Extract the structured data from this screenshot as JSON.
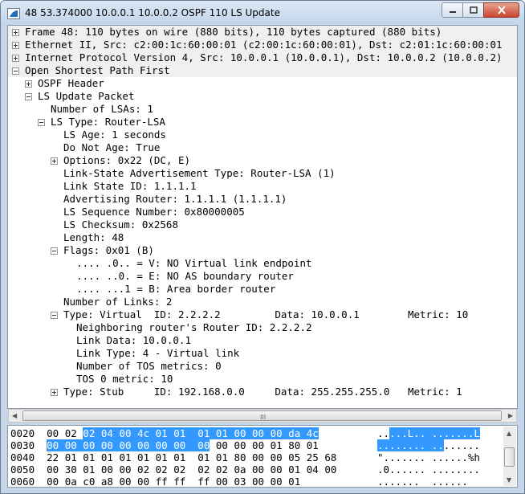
{
  "window": {
    "title": "48 53.374000 10.0.0.1 10.0.0.2 OSPF 110 LS Update",
    "minimize_label": "–",
    "maximize_label": "□",
    "close_label": "✕"
  },
  "tree": [
    {
      "text": "Frame 48: 110 bytes on wire (880 bits), 110 bytes captured (880 bits)",
      "expander": "plus"
    },
    {
      "text": "Ethernet II, Src: c2:00:1c:60:00:01 (c2:00:1c:60:00:01), Dst: c2:01:1c:60:00:01",
      "expander": "plus"
    },
    {
      "text": "Internet Protocol Version 4, Src: 10.0.0.1 (10.0.0.1), Dst: 10.0.0.2 (10.0.0.2)",
      "expander": "plus"
    },
    {
      "text": "Open Shortest Path First",
      "expander": "minus"
    },
    {
      "text": "OSPF Header",
      "expander": "plus"
    },
    {
      "text": "LS Update Packet",
      "expander": "minus"
    },
    {
      "text": "Number of LSAs: 1",
      "expander": "none"
    },
    {
      "text": "LS Type: Router-LSA",
      "expander": "minus"
    },
    {
      "text": "LS Age: 1 seconds",
      "expander": "none"
    },
    {
      "text": "Do Not Age: True",
      "expander": "none"
    },
    {
      "text": "Options: 0x22 (DC, E)",
      "expander": "plus"
    },
    {
      "text": "Link-State Advertisement Type: Router-LSA (1)",
      "expander": "none"
    },
    {
      "text": "Link State ID: 1.1.1.1",
      "expander": "none"
    },
    {
      "text": "Advertising Router: 1.1.1.1 (1.1.1.1)",
      "expander": "none"
    },
    {
      "text": "LS Sequence Number: 0x80000005",
      "expander": "none"
    },
    {
      "text": "LS Checksum: 0x2568",
      "expander": "none"
    },
    {
      "text": "Length: 48",
      "expander": "none"
    },
    {
      "text": "Flags: 0x01 (B)",
      "expander": "minus"
    },
    {
      "text": ".... .0.. = V: NO Virtual link endpoint",
      "expander": "none"
    },
    {
      "text": ".... ..0. = E: NO AS boundary router",
      "expander": "none"
    },
    {
      "text": ".... ...1 = B: Area border router",
      "expander": "none"
    },
    {
      "text": "Number of Links: 2",
      "expander": "none"
    },
    {
      "text": "Type: Virtual  ID: 2.2.2.2         Data: 10.0.0.1        Metric: 10",
      "expander": "minus"
    },
    {
      "text": "Neighboring router's Router ID: 2.2.2.2",
      "expander": "none"
    },
    {
      "text": "Link Data: 10.0.0.1",
      "expander": "none"
    },
    {
      "text": "Link Type: 4 - Virtual link",
      "expander": "none"
    },
    {
      "text": "Number of TOS metrics: 0",
      "expander": "none"
    },
    {
      "text": "TOS 0 metric: 10",
      "expander": "none"
    },
    {
      "text": "Type: Stub     ID: 192.168.0.0     Data: 255.255.255.0   Metric: 1",
      "expander": "plus"
    }
  ],
  "hex": [
    {
      "offset": "0020",
      "plain1": "00 02 ",
      "sel": "02 04 00 4c 01 01  01 01 00 00 00 da 4c",
      "plain2": "",
      "ascii_plain": "..",
      "ascii_sel": "...L.. .......L"
    },
    {
      "offset": "0030",
      "plain1": "",
      "sel": "00 00 00 00 00 00 00 00  00",
      "plain2": " 00 00 00 01 80 01",
      "ascii_plain": "",
      "ascii_sel": "........ ..",
      "ascii_plain2": "......"
    },
    {
      "offset": "0040",
      "plain1": "22 01 01 01 01 01 01 01  01 01 80 00 00 05 25 68",
      "sel": "",
      "plain2": "",
      "ascii_plain": "\"....... ......%h",
      "ascii_sel": ""
    },
    {
      "offset": "0050",
      "plain1": "00 30 01 00 00 02 02 02  02 02 0a 00 00 01 04 00",
      "sel": "",
      "plain2": "",
      "ascii_plain": ".0...... ........",
      "ascii_sel": ""
    },
    {
      "offset": "0060",
      "plain1": "00 0a c0 a8 00 00 ff ff  ff 00 03 00 00 01",
      "sel": "",
      "plain2": "",
      "ascii_plain": ".......  ......",
      "ascii_sel": ""
    }
  ],
  "scrollbar": {
    "grip": "III"
  }
}
